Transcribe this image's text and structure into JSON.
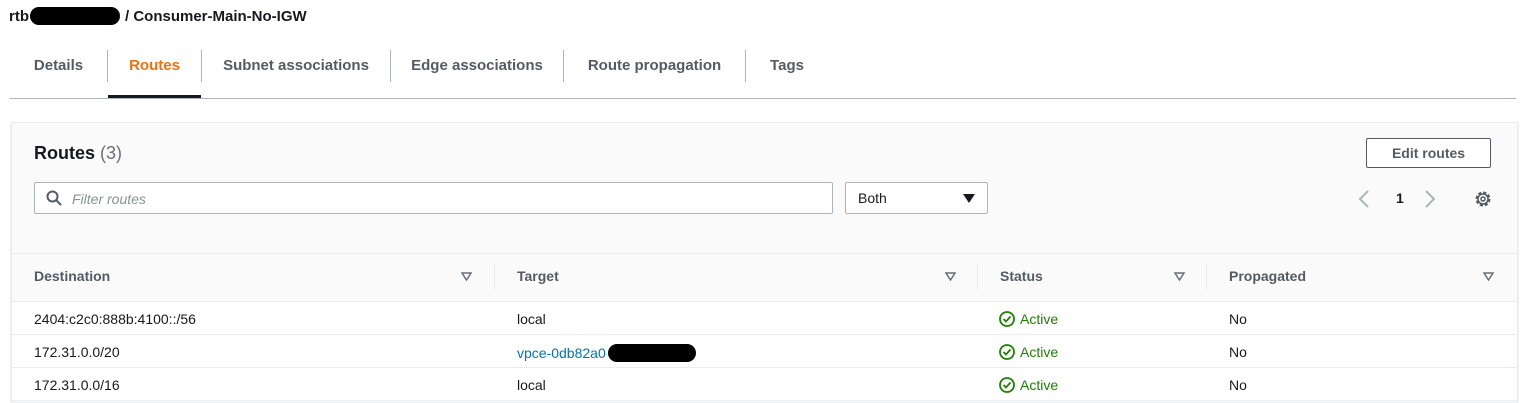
{
  "header": {
    "prefix": "rtb",
    "title": "/ Consumer-Main-No-IGW"
  },
  "tabs": [
    {
      "label": "Details"
    },
    {
      "label": "Routes"
    },
    {
      "label": "Subnet associations"
    },
    {
      "label": "Edge associations"
    },
    {
      "label": "Route propagation"
    },
    {
      "label": "Tags"
    }
  ],
  "active_tab": "Routes",
  "panel": {
    "title": "Routes",
    "count": "(3)",
    "edit_button": "Edit routes",
    "filter_placeholder": "Filter routes",
    "select_value": "Both",
    "page": "1"
  },
  "columns": [
    "Destination",
    "Target",
    "Status",
    "Propagated"
  ],
  "rows": [
    {
      "destination": "2404:c2c0:888b:4100::/56",
      "target": "local",
      "status": "Active",
      "propagated": "No"
    },
    {
      "destination": "172.31.0.0/20",
      "target": "vpce-0db82a0",
      "status": "Active",
      "propagated": "No"
    },
    {
      "destination": "172.31.0.0/16",
      "target": "local",
      "status": "Active",
      "propagated": "No"
    }
  ],
  "colors": {
    "accent": "#ec7211",
    "link": "#0073bb",
    "success": "#1d8102"
  },
  "icons": [
    "search-icon",
    "caret-down-icon",
    "chevron-left-icon",
    "chevron-right-icon",
    "gear-icon",
    "sort-icon",
    "check-circle-icon"
  ]
}
